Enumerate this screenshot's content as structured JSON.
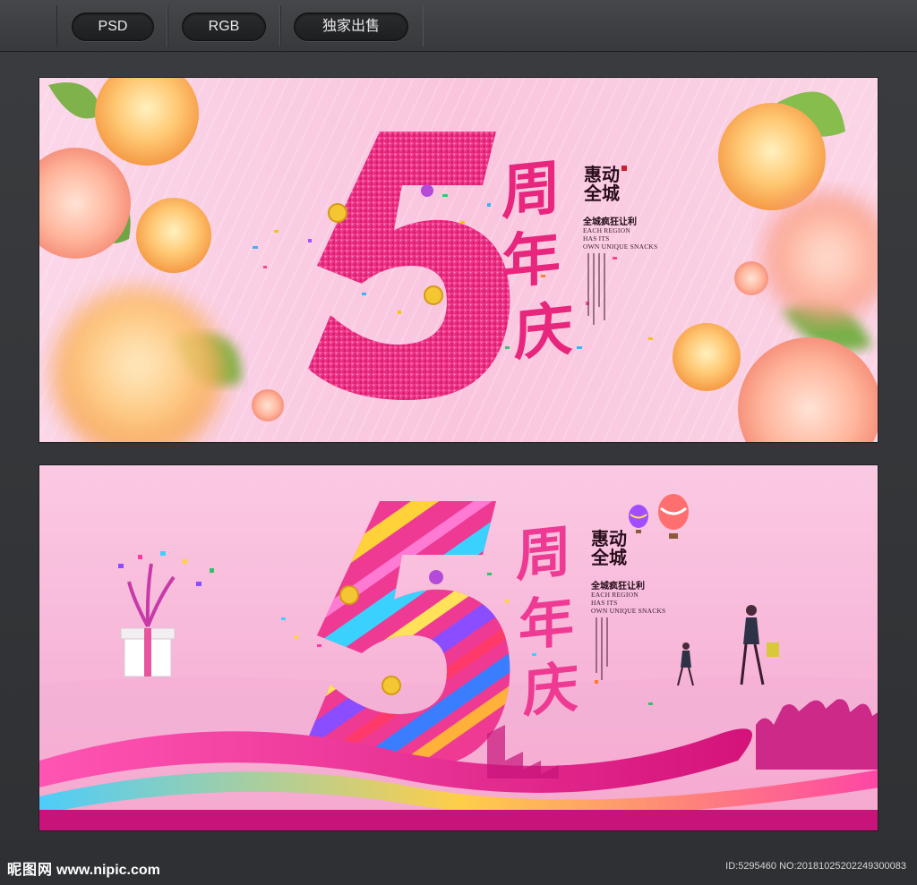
{
  "toolbar": {
    "buttons": [
      {
        "label": "PSD"
      },
      {
        "label": "RGB"
      },
      {
        "label": "独家出售"
      }
    ]
  },
  "banner1": {
    "numeral": "5",
    "headline_chars": [
      "周",
      "年",
      "庆"
    ],
    "promo_title_line1": "惠动",
    "promo_title_line2": "全城",
    "promo_subtitle": "全城疯狂让利",
    "english_lines": [
      "EACH REGION",
      "HAS ITS",
      "OWN UNIQUE SNACKS"
    ],
    "colors": {
      "accent": "#e8267e",
      "background": "#f9c5de"
    }
  },
  "banner2": {
    "numeral": "5",
    "headline_chars": [
      "周",
      "年",
      "庆"
    ],
    "promo_title_line1": "惠动",
    "promo_title_line2": "全城",
    "promo_subtitle": "全城疯狂让利",
    "english_lines": [
      "EACH REGION",
      "HAS ITS",
      "OWN UNIQUE SNACKS"
    ],
    "colors": {
      "accent": "#ee3a93",
      "background": "#f7b6d8"
    }
  },
  "footer": {
    "brand": "昵图网",
    "url": "www.nipic.com",
    "image_id": "ID:5295460 NO:20181025202249300083"
  },
  "icons": {
    "flower": "flower-icon",
    "balloon": "hot-air-balloon-icon",
    "gift": "gift-box-icon",
    "coin": "coin-icon",
    "seal": "red-seal-icon"
  }
}
